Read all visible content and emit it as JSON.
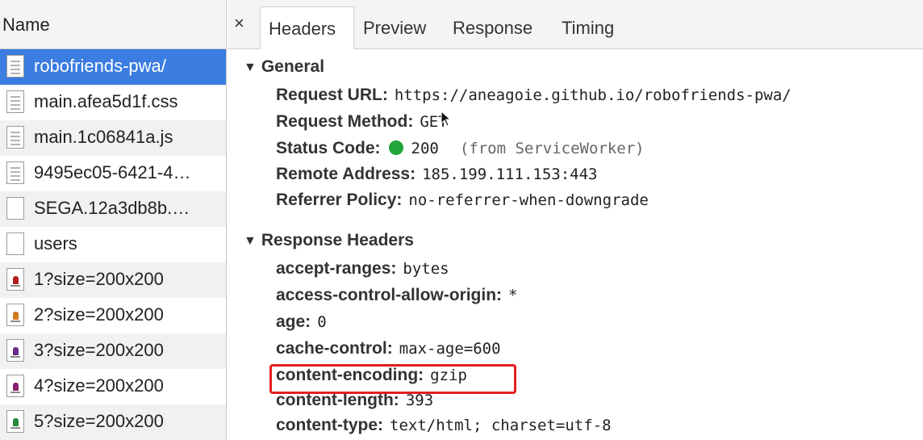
{
  "left_panel": {
    "header": "Name",
    "files": [
      {
        "name": "robofriends-pwa/",
        "icon": "document-icon",
        "selected": true
      },
      {
        "name": "main.afea5d1f.css",
        "icon": "document-icon"
      },
      {
        "name": "main.1c06841a.js",
        "icon": "document-icon"
      },
      {
        "name": "9495ec05-6421-4…",
        "icon": "document-icon"
      },
      {
        "name": "SEGA.12a3db8b.…",
        "icon": "blank-file-icon"
      },
      {
        "name": "users",
        "icon": "blank-file-icon"
      },
      {
        "name": "1?size=200x200",
        "icon": "robot-image-icon",
        "color": "#b32222"
      },
      {
        "name": "2?size=200x200",
        "icon": "robot-image-icon",
        "color": "#d07a20"
      },
      {
        "name": "3?size=200x200",
        "icon": "robot-image-icon",
        "color": "#6a2a8a"
      },
      {
        "name": "4?size=200x200",
        "icon": "robot-image-icon",
        "color": "#8a2070"
      },
      {
        "name": "5?size=200x200",
        "icon": "robot-image-icon",
        "color": "#2a8a3a"
      }
    ]
  },
  "tabs": {
    "close": "×",
    "items": [
      "Headers",
      "Preview",
      "Response",
      "Timing"
    ],
    "active": "Headers"
  },
  "general": {
    "title": "General",
    "request_url": {
      "key": "Request URL:",
      "value": "https://aneagoie.github.io/robofriends-pwa/"
    },
    "request_method": {
      "key": "Request Method:",
      "value": "GET"
    },
    "status_code": {
      "key": "Status Code:",
      "value": "200",
      "note": "(from ServiceWorker)",
      "dot_color": "#21a53a"
    },
    "remote_address": {
      "key": "Remote Address:",
      "value": "185.199.111.153:443"
    },
    "referrer_policy": {
      "key": "Referrer Policy:",
      "value": "no-referrer-when-downgrade"
    }
  },
  "response_headers": {
    "title": "Response Headers",
    "items": [
      {
        "key": "accept-ranges:",
        "value": "bytes"
      },
      {
        "key": "access-control-allow-origin:",
        "value": "*"
      },
      {
        "key": "age:",
        "value": "0"
      },
      {
        "key": "cache-control:",
        "value": "max-age=600"
      },
      {
        "key": "content-encoding:",
        "value": "gzip",
        "highlighted": true
      },
      {
        "key": "content-length:",
        "value": "393"
      },
      {
        "key": "content-type:",
        "value": "text/html; charset=utf-8"
      }
    ]
  },
  "colors": {
    "selection": "#3b7de0",
    "highlight": "#e41f1f",
    "status_ok": "#21a53a"
  }
}
